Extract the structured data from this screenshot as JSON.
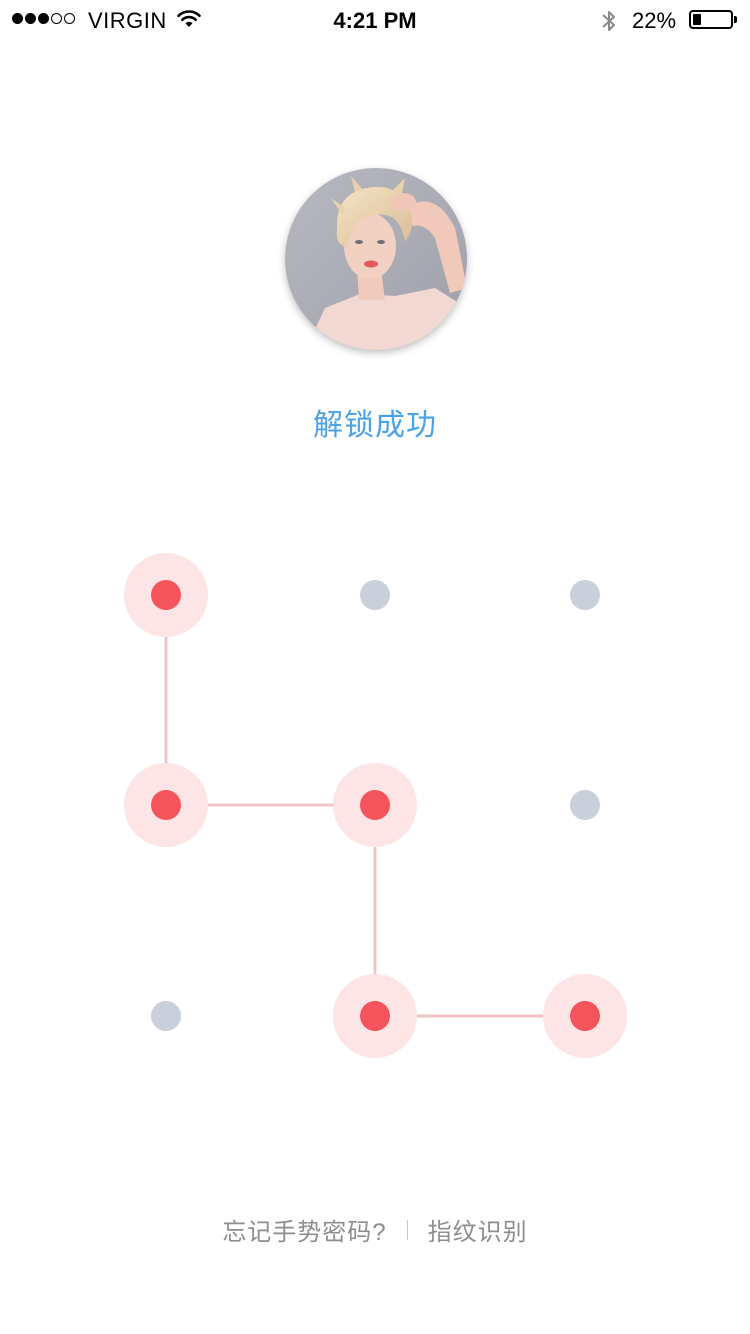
{
  "status_bar": {
    "signal_filled": 3,
    "signal_empty": 2,
    "carrier": "VIRGIN",
    "time": "4:21 PM",
    "battery_percent": "22%",
    "battery_level": 0.22
  },
  "lock": {
    "status_text": "解锁成功",
    "pattern_sequence": [
      1,
      4,
      5,
      8,
      9
    ],
    "active_nodes": [
      1,
      4,
      5,
      8,
      9
    ],
    "idle_nodes": [
      2,
      3,
      6,
      7
    ],
    "colors": {
      "accent_blue": "#4aa4ec",
      "active_dot": "#f4545c",
      "active_halo": "#fde5e6",
      "line": "#f0c4c6",
      "idle_dot": "#c9cfdb"
    }
  },
  "footer": {
    "forgot_label": "忘记手势密码?",
    "fingerprint_label": "指纹识别"
  },
  "icons": {
    "wifi": "wifi-icon",
    "bluetooth": "bluetooth-icon",
    "battery": "battery-icon",
    "avatar": "user-avatar-photo"
  }
}
